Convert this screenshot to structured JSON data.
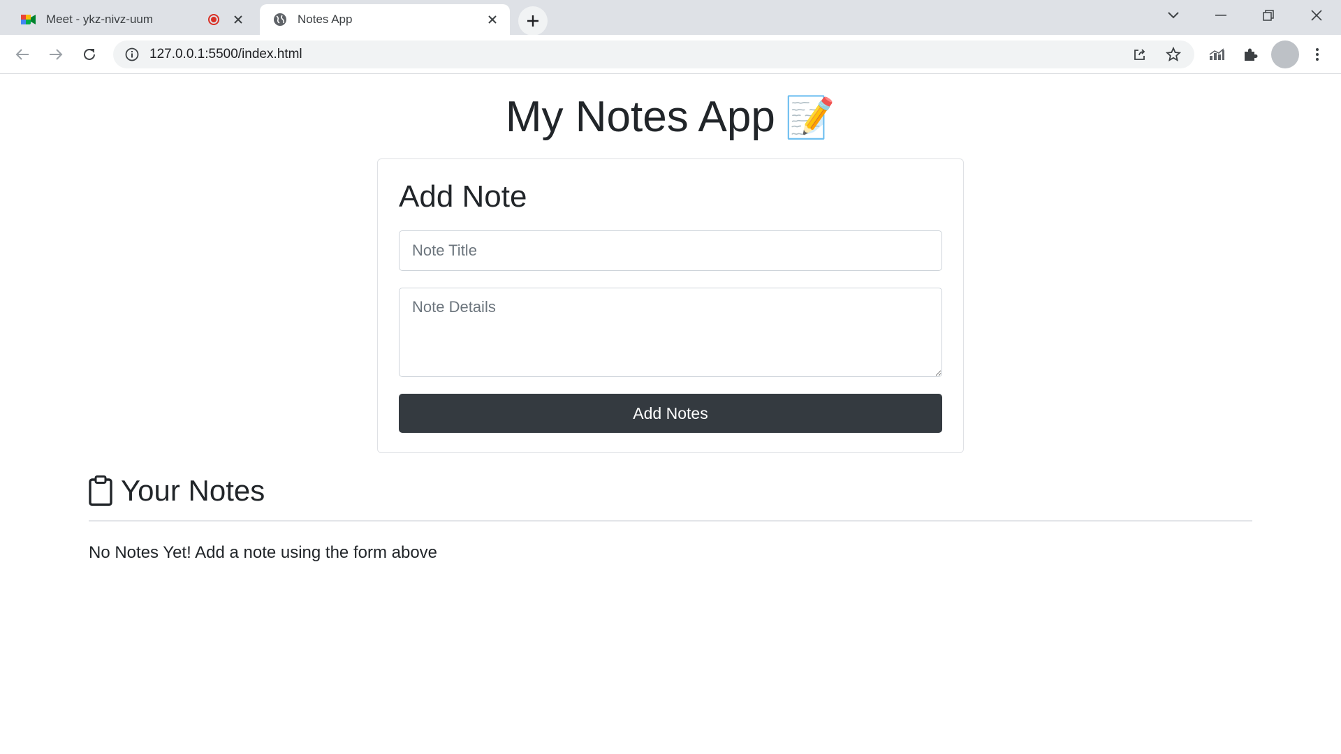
{
  "browser": {
    "tabs": [
      {
        "title": "Meet - ykz-nivz-uum",
        "active": false,
        "favicon": "google-meet-icon",
        "recording": true
      },
      {
        "title": "Notes App",
        "active": true,
        "favicon": "globe-icon"
      }
    ],
    "url": "127.0.0.1:5500/index.html"
  },
  "app": {
    "title": "My Notes App",
    "title_emoji": "📝",
    "add_card": {
      "heading": "Add Note",
      "title_placeholder": "Note Title",
      "details_placeholder": "Note Details",
      "button_label": "Add Notes"
    },
    "notes_section": {
      "heading": "Your Notes",
      "icon": "clipboard-icon",
      "empty_message": "No Notes Yet! Add a note using the form above"
    }
  },
  "colors": {
    "button_bg": "#343a40",
    "button_text": "#ffffff",
    "text": "#212529",
    "chrome_bg": "#dee1e6"
  }
}
